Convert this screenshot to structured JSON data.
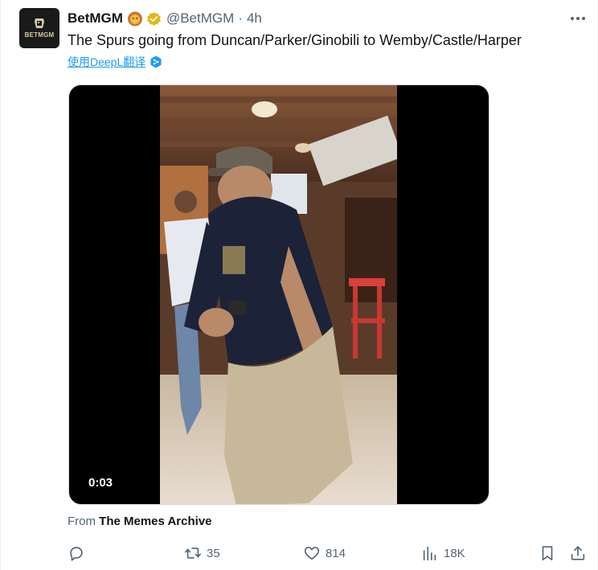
{
  "tweet": {
    "display_name": "BetMGM",
    "handle": "@BetMGM",
    "separator": "·",
    "time": "4h",
    "text": "The Spurs going from Duncan/Parker/Ginobili to Wemby/Castle/Harper",
    "avatar_label": "BETMGM",
    "translate_label": "使用DeepL翻译",
    "icons": {
      "avatar": "betmgm-logo",
      "name_emoji": "lion-face-emoji",
      "verified": "gold-verified-badge",
      "more": "more-horizontal-icon",
      "translate": "deepl-icon"
    }
  },
  "media": {
    "type": "video",
    "timestamp": "0:03"
  },
  "source": {
    "prefix": "From",
    "name": "The Memes Archive"
  },
  "actions": {
    "reply": {
      "icon": "reply-icon",
      "count": ""
    },
    "retweet": {
      "icon": "retweet-icon",
      "count": "35"
    },
    "like": {
      "icon": "heart-icon",
      "count": "814"
    },
    "views": {
      "icon": "views-chart-icon",
      "count": "18K"
    },
    "bookmark": {
      "icon": "bookmark-icon"
    },
    "share": {
      "icon": "share-icon"
    }
  },
  "colors": {
    "text": "#0f1419",
    "secondary": "#536471",
    "link": "#1d9bf0",
    "verified_gold": "#e2b719",
    "border": "#cfd9de"
  }
}
